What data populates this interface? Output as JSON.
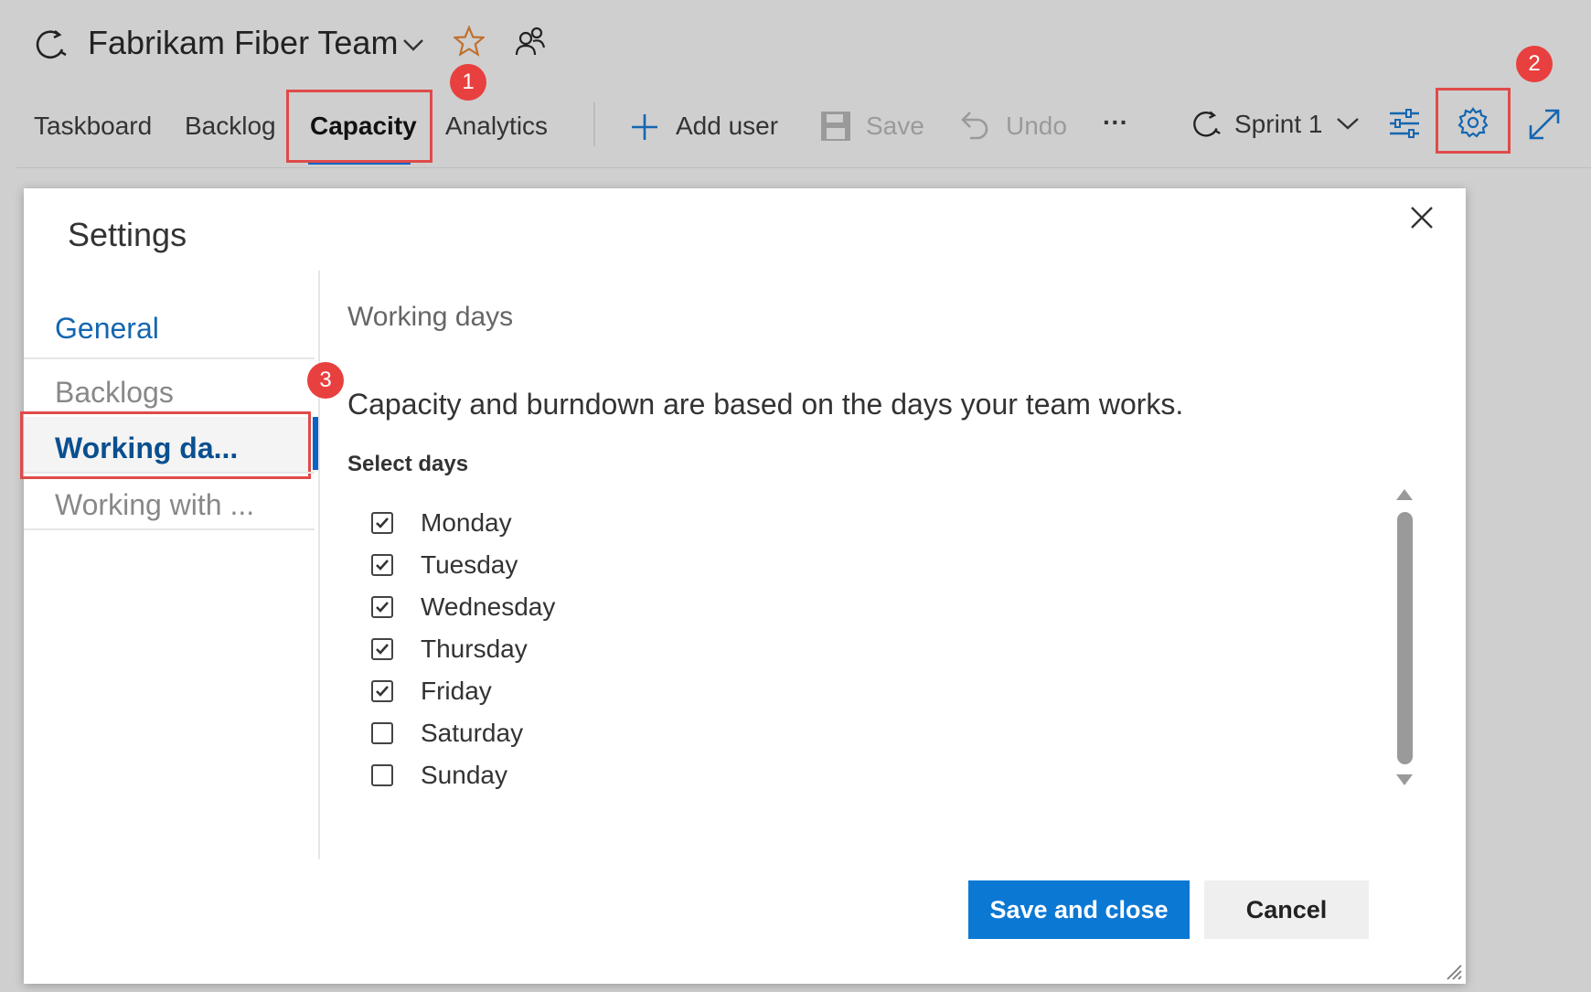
{
  "header": {
    "team_name": "Fabrikam Fiber Team"
  },
  "tabs": [
    {
      "label": "Taskboard"
    },
    {
      "label": "Backlog"
    },
    {
      "label": "Capacity"
    },
    {
      "label": "Analytics"
    }
  ],
  "toolbar": {
    "add_user_label": "Add user",
    "save_label": "Save",
    "undo_label": "Undo",
    "more_label": "···",
    "sprint_label": "Sprint 1"
  },
  "badges": {
    "one": "1",
    "two": "2",
    "three": "3"
  },
  "dialog": {
    "title": "Settings",
    "nav": [
      {
        "label": "General"
      },
      {
        "label": "Backlogs"
      },
      {
        "label": "Working da..."
      },
      {
        "label": "Working with ..."
      }
    ],
    "section_heading": "Working days",
    "description": "Capacity and burndown are based on the days your team works.",
    "select_days_label": "Select days",
    "days": [
      {
        "label": "Monday",
        "checked": true
      },
      {
        "label": "Tuesday",
        "checked": true
      },
      {
        "label": "Wednesday",
        "checked": true
      },
      {
        "label": "Thursday",
        "checked": true
      },
      {
        "label": "Friday",
        "checked": true
      },
      {
        "label": "Saturday",
        "checked": false
      },
      {
        "label": "Sunday",
        "checked": false
      }
    ],
    "save_close_label": "Save and close",
    "cancel_label": "Cancel"
  },
  "colors": {
    "accent": "#0b78d4",
    "annotation_red": "#e8403f",
    "nav_selected": "#0a4f8f"
  }
}
